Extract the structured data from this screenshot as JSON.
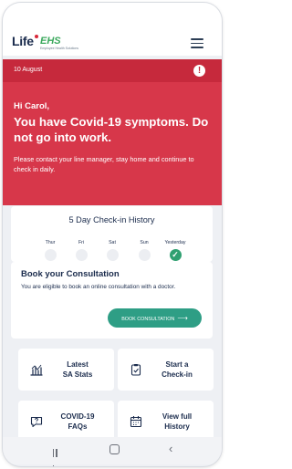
{
  "header": {
    "logo_main": "Life",
    "logo_sub": "EHS",
    "logo_tagline": "Employee Health Solutions",
    "menu_icon": "hamburger-menu-icon"
  },
  "banner": {
    "date": "10 August",
    "alert_icon": "!",
    "greeting": "Hi Carol,",
    "headline": "You have Covid-19 symptoms. Do not go into work.",
    "message": "Please contact your line manager, stay home and continue to check in daily."
  },
  "checkin_history": {
    "title": "5 Day Check-in History",
    "days": [
      {
        "label": "Thur",
        "checked": false
      },
      {
        "label": "Fri",
        "checked": false
      },
      {
        "label": "Sat",
        "checked": false
      },
      {
        "label": "Sun",
        "checked": false
      },
      {
        "label": "Yesterday",
        "checked": true
      }
    ],
    "check_glyph": "✓"
  },
  "consultation": {
    "title": "Book your Consultation",
    "text": "You are eligible to book an online consultation with a doctor.",
    "button_label": "BOOK CONSULTATION",
    "button_arrow": "⟶"
  },
  "tiles": [
    {
      "line1": "Latest",
      "line2": "SA Stats",
      "icon": "bar-chart-icon"
    },
    {
      "line1": "Start a",
      "line2": "Check-in",
      "icon": "clipboard-check-icon"
    },
    {
      "line1": "COVID-19",
      "line2": "FAQs",
      "icon": "question-chat-icon"
    },
    {
      "line1": "View full",
      "line2": "History",
      "icon": "calendar-icon"
    }
  ],
  "system_nav": {
    "back_glyph": "‹"
  },
  "colors": {
    "brand_red": "#d7374a",
    "accent_green": "#2e9e85",
    "text_navy": "#1a2b4c"
  }
}
